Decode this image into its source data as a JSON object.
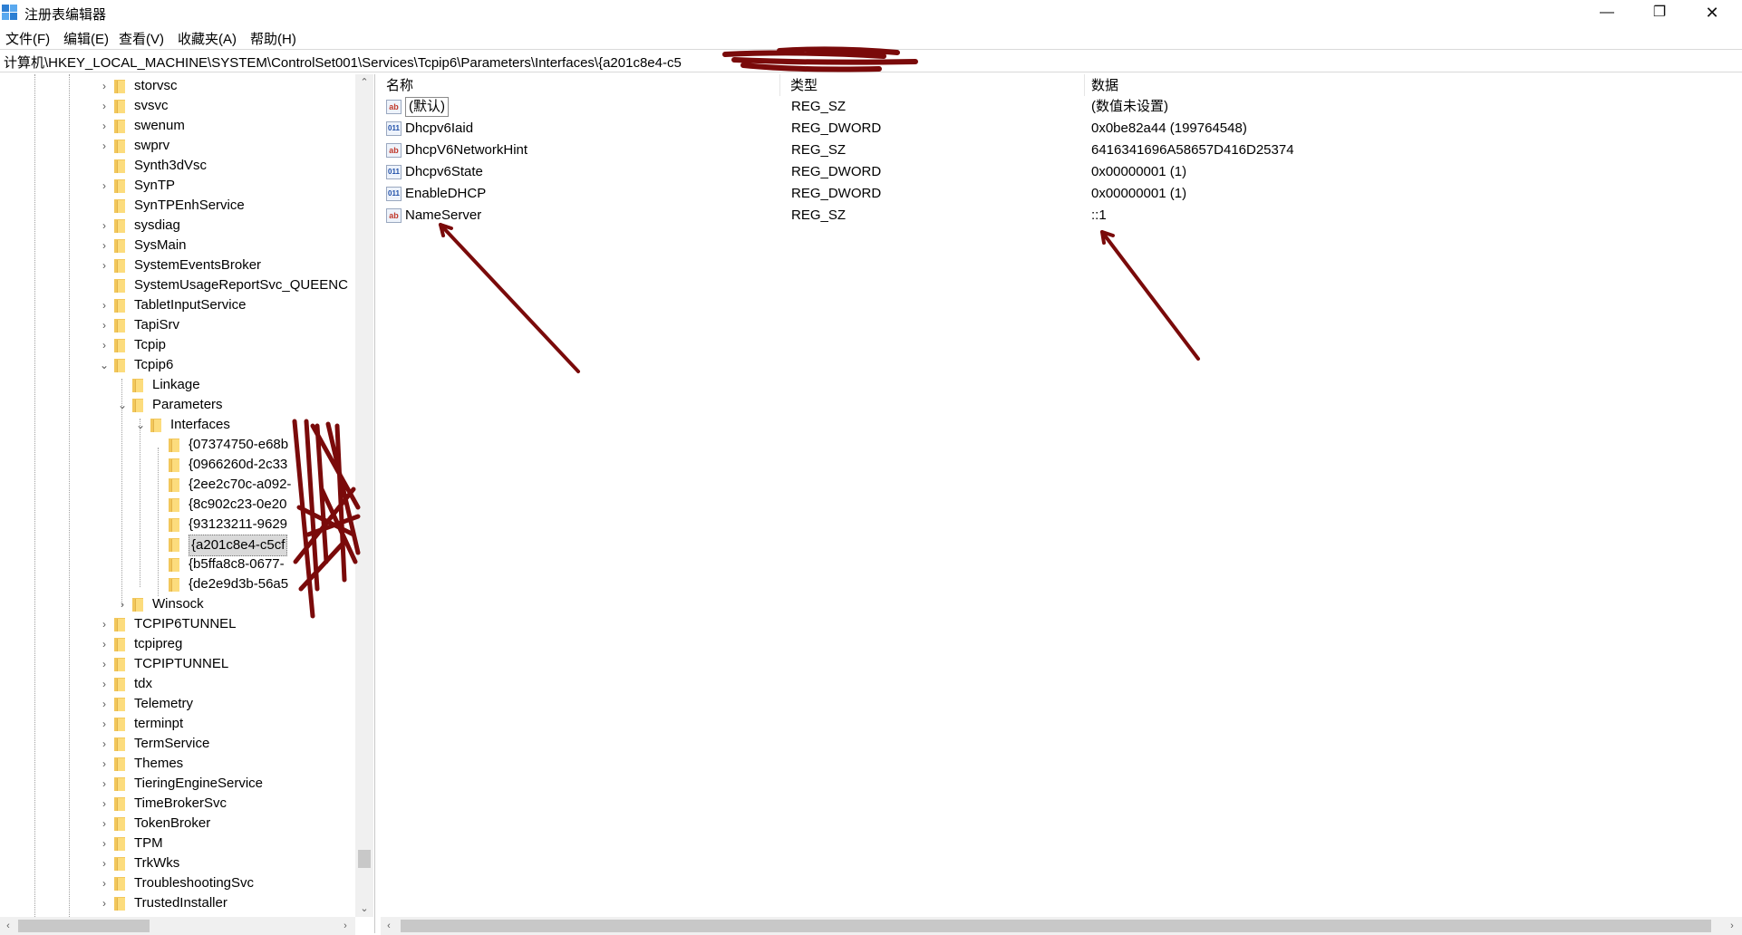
{
  "window": {
    "title": "注册表编辑器",
    "minimize_glyph": "—",
    "maximize_glyph": "❐",
    "close_glyph": "✕"
  },
  "menu": [
    "文件(F)",
    "编辑(E)",
    "查看(V)",
    "收藏夹(A)",
    "帮助(H)"
  ],
  "address": {
    "path": "计算机\\HKEY_LOCAL_MACHINE\\SYSTEM\\ControlSet001\\Services\\Tcpip6\\Parameters\\Interfaces\\{a201c8e4-c5"
  },
  "tree": {
    "items": [
      {
        "label": "storvsc",
        "expander": "›"
      },
      {
        "label": "svsvc",
        "expander": "›"
      },
      {
        "label": "swenum",
        "expander": "›"
      },
      {
        "label": "swprv",
        "expander": "›"
      },
      {
        "label": "Synth3dVsc",
        "expander": ""
      },
      {
        "label": "SynTP",
        "expander": "›"
      },
      {
        "label": "SynTPEnhService",
        "expander": ""
      },
      {
        "label": "sysdiag",
        "expander": "›"
      },
      {
        "label": "SysMain",
        "expander": "›"
      },
      {
        "label": "SystemEventsBroker",
        "expander": "›"
      },
      {
        "label": "SystemUsageReportSvc_QUEENC",
        "expander": ""
      },
      {
        "label": "TabletInputService",
        "expander": "›"
      },
      {
        "label": "TapiSrv",
        "expander": "›"
      },
      {
        "label": "Tcpip",
        "expander": "›"
      },
      {
        "label": "Tcpip6",
        "expander": "⌄"
      },
      {
        "label": "Linkage",
        "expander": ""
      },
      {
        "label": "Parameters",
        "expander": "⌄"
      },
      {
        "label": "Interfaces",
        "expander": "⌄"
      },
      {
        "label": "{07374750-e68b",
        "expander": ""
      },
      {
        "label": "{0966260d-2c33",
        "expander": ""
      },
      {
        "label": "{2ee2c70c-a092-",
        "expander": ""
      },
      {
        "label": "{8c902c23-0e20",
        "expander": ""
      },
      {
        "label": "{93123211-9629",
        "expander": ""
      },
      {
        "label": "{a201c8e4-c5cf",
        "expander": ""
      },
      {
        "label": "{b5ffa8c8-0677-",
        "expander": ""
      },
      {
        "label": "{de2e9d3b-56a5",
        "expander": ""
      },
      {
        "label": "Winsock",
        "expander": "›"
      },
      {
        "label": "TCPIP6TUNNEL",
        "expander": "›"
      },
      {
        "label": "tcpipreg",
        "expander": "›"
      },
      {
        "label": "TCPIPTUNNEL",
        "expander": "›"
      },
      {
        "label": "tdx",
        "expander": "›"
      },
      {
        "label": "Telemetry",
        "expander": "›"
      },
      {
        "label": "terminpt",
        "expander": "›"
      },
      {
        "label": "TermService",
        "expander": "›"
      },
      {
        "label": "Themes",
        "expander": "›"
      },
      {
        "label": "TieringEngineService",
        "expander": "›"
      },
      {
        "label": "TimeBrokerSvc",
        "expander": "›"
      },
      {
        "label": "TokenBroker",
        "expander": "›"
      },
      {
        "label": "TPM",
        "expander": "›"
      },
      {
        "label": "TrkWks",
        "expander": "›"
      },
      {
        "label": "TroubleshootingSvc",
        "expander": "›"
      },
      {
        "label": "TrustedInstaller",
        "expander": "›"
      }
    ]
  },
  "list": {
    "headers": {
      "name": "名称",
      "type": "类型",
      "data": "数据"
    },
    "rows": [
      {
        "icon": "ab",
        "name": "(默认)",
        "type": "REG_SZ",
        "data": "(数值未设置)"
      },
      {
        "icon": "011",
        "name": "Dhcpv6Iaid",
        "type": "REG_DWORD",
        "data": "0x0be82a44 (199764548)"
      },
      {
        "icon": "ab",
        "name": "DhcpV6NetworkHint",
        "type": "REG_SZ",
        "data": "6416341696A58657D416D25374"
      },
      {
        "icon": "011",
        "name": "Dhcpv6State",
        "type": "REG_DWORD",
        "data": "0x00000001 (1)"
      },
      {
        "icon": "011",
        "name": "EnableDHCP",
        "type": "REG_DWORD",
        "data": "0x00000001 (1)"
      },
      {
        "icon": "ab",
        "name": "NameServer",
        "type": "REG_SZ",
        "data": "::1"
      }
    ]
  },
  "scroll": {
    "up": "⌃",
    "down": "⌄",
    "left": "‹",
    "right": "›"
  },
  "colors": {
    "annotation": "#7a0a0a",
    "selection": "#d9d9d9"
  }
}
